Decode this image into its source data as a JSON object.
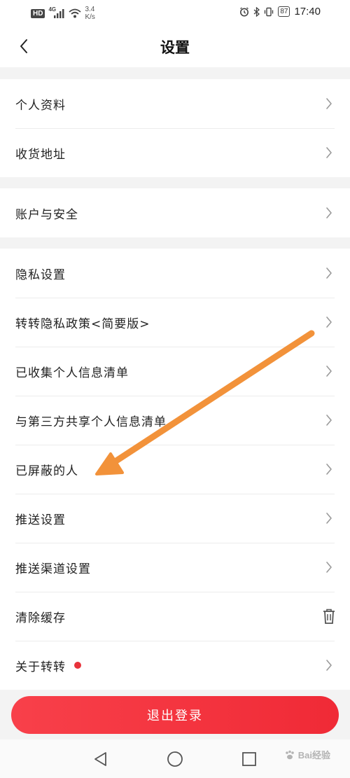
{
  "status_bar": {
    "hd": "HD",
    "network": "4G",
    "speed_value": "3.4",
    "speed_unit": "K/s",
    "battery": "87",
    "time": "17:40"
  },
  "nav": {
    "title": "设置"
  },
  "groups": [
    {
      "items": [
        {
          "label": "个人资料",
          "end": "chevron"
        },
        {
          "label": "收货地址",
          "end": "chevron"
        }
      ]
    },
    {
      "items": [
        {
          "label": "账户与安全",
          "end": "chevron"
        }
      ]
    },
    {
      "items": [
        {
          "label": "隐私设置",
          "end": "chevron"
        },
        {
          "label": "转转隐私政策<简要版>",
          "end": "chevron"
        },
        {
          "label": "已收集个人信息清单",
          "end": "chevron"
        },
        {
          "label": "与第三方共享个人信息清单",
          "end": "chevron"
        },
        {
          "label": "已屏蔽的人",
          "end": "chevron"
        },
        {
          "label": "推送设置",
          "end": "chevron"
        },
        {
          "label": "推送渠道设置",
          "end": "chevron"
        },
        {
          "label": "清除缓存",
          "end": "trash-icon"
        },
        {
          "label": "关于转转",
          "end": "chevron",
          "red_dot": true
        }
      ]
    }
  ],
  "logout_label": "退出登录",
  "watermark": "Bai经验",
  "colors": {
    "accent": "#f0303a",
    "annotation_arrow": "#f2923a"
  }
}
